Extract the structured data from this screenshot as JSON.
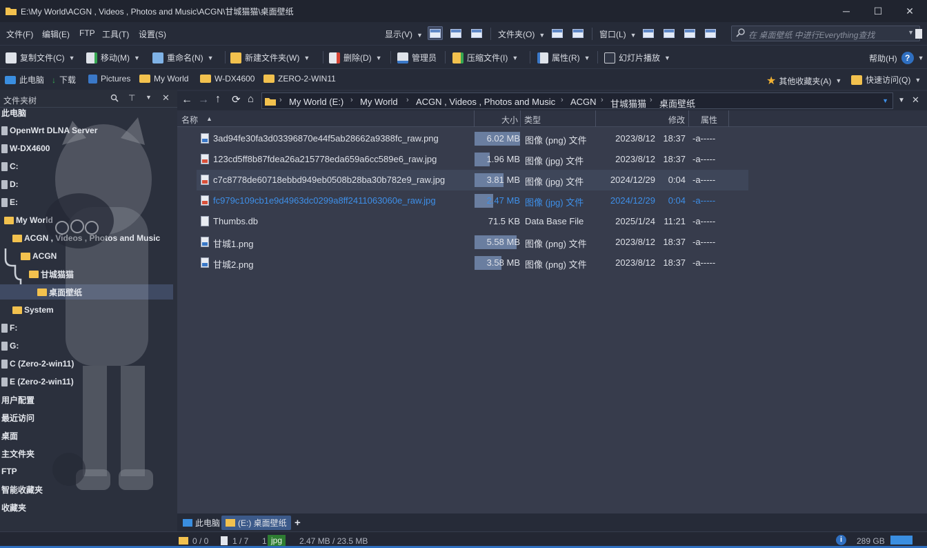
{
  "window": {
    "title": "E:\\My World\\ACGN , Videos , Photos and Music\\ACGN\\甘城猫猫\\桌面壁纸",
    "minimize": "─",
    "maximize": "☐",
    "close": "✕"
  },
  "menu": {
    "file": "文件(F)",
    "edit": "编辑(E)",
    "ftp": "FTP",
    "tools": "工具(T)",
    "settings": "设置(S)",
    "view": "显示(V)",
    "folders": "文件夹(O)",
    "window": "窗口(L)"
  },
  "search": {
    "placeholder": "在 桌面壁纸 中进行Everything查找"
  },
  "toolbar": {
    "copy": "复制文件(C)",
    "move": "移动(M)",
    "rename": "重命名(N)",
    "new_folder": "新建文件夹(W)",
    "delete": "删除(D)",
    "admin": "管理员",
    "compress": "压缩文件(I)",
    "properties": "属性(R)",
    "slideshow": "幻灯片播放",
    "help": "帮助(H)"
  },
  "favorites": {
    "items": [
      "此电脑",
      "下载",
      "Pictures",
      "My World",
      "W-DX4600",
      "ZERO-2-WIN11"
    ],
    "other": "其他收藏夹(A)",
    "quick": "快速访问(Q)"
  },
  "tree": {
    "header": "文件夹树",
    "items": [
      "此电脑",
      "OpenWrt DLNA Server",
      "W-DX4600",
      "C:",
      "D:",
      "E:",
      "My World",
      "ACGN , Videos , Photos and Music",
      "ACGN",
      "甘城猫猫",
      "桌面壁纸",
      "System",
      "F:",
      "G:",
      "C (Zero-2-win11)",
      "E (Zero-2-win11)",
      "用户配置",
      "最近访问",
      "桌面",
      "主文件夹",
      "FTP",
      "智能收藏夹",
      "收藏夹"
    ]
  },
  "address": {
    "crumbs": [
      "My World (E:)",
      "My World",
      "ACGN , Videos , Photos and Music",
      "ACGN",
      "甘城猫猫",
      "桌面壁纸"
    ]
  },
  "columns": {
    "name": "名称",
    "size": "大小",
    "type": "类型",
    "modified": "修改",
    "attr": "属性"
  },
  "files": [
    {
      "name": "3ad94fe30fa3d03396870e44f5ab28662a9388fc_raw.png",
      "size": "6.02 MB",
      "size_fraction": 1.0,
      "type": "图像 (png) 文件",
      "date": "2023/8/12",
      "time": "18:37",
      "attr": "-a-----",
      "kind": "png"
    },
    {
      "name": "123cd5ff8b87fdea26a215778eda659a6cc589e6_raw.jpg",
      "size": "1.96 MB",
      "size_fraction": 0.33,
      "type": "图像 (jpg) 文件",
      "date": "2023/8/12",
      "time": "18:37",
      "attr": "-a-----",
      "kind": "jpg"
    },
    {
      "name": "c7c8778de60718ebbd949eb0508b28ba30b782e9_raw.jpg",
      "size": "3.81 MB",
      "size_fraction": 0.63,
      "type": "图像 (jpg) 文件",
      "date": "2024/12/29",
      "time": "0:04",
      "attr": "-a-----",
      "kind": "jpg"
    },
    {
      "name": "fc979c109cb1e9d4963dc0299a8ff2411063060e_raw.jpg",
      "size": "2.47 MB",
      "size_fraction": 0.41,
      "type": "图像 (jpg) 文件",
      "date": "2024/12/29",
      "time": "0:04",
      "attr": "-a-----",
      "kind": "jpg"
    },
    {
      "name": "Thumbs.db",
      "size": "71.5 KB",
      "size_fraction": 0,
      "type": "Data Base File",
      "date": "2025/1/24",
      "time": "11:21",
      "attr": "-a-----",
      "kind": "db"
    },
    {
      "name": "甘城1.png",
      "size": "5.58 MB",
      "size_fraction": 0.93,
      "type": "图像 (png) 文件",
      "date": "2023/8/12",
      "time": "18:37",
      "attr": "-a-----",
      "kind": "png"
    },
    {
      "name": "甘城2.png",
      "size": "3.58 MB",
      "size_fraction": 0.59,
      "type": "图像 (png) 文件",
      "date": "2023/8/12",
      "time": "18:37",
      "attr": "-a-----",
      "kind": "png"
    }
  ],
  "tabs": {
    "pc": "此电脑",
    "current": "(E:) 桌面壁纸",
    "add": "+"
  },
  "status": {
    "folders": "0 / 0",
    "files": "1 / 7",
    "sel_count": "1",
    "ext": "jpg",
    "sizes": "2.47 MB / 23.5 MB",
    "free": "289 GB"
  },
  "colors": {
    "accent": "#3c5a8a",
    "selected_text": "#3e8fe8",
    "folder": "#f2c14e"
  }
}
